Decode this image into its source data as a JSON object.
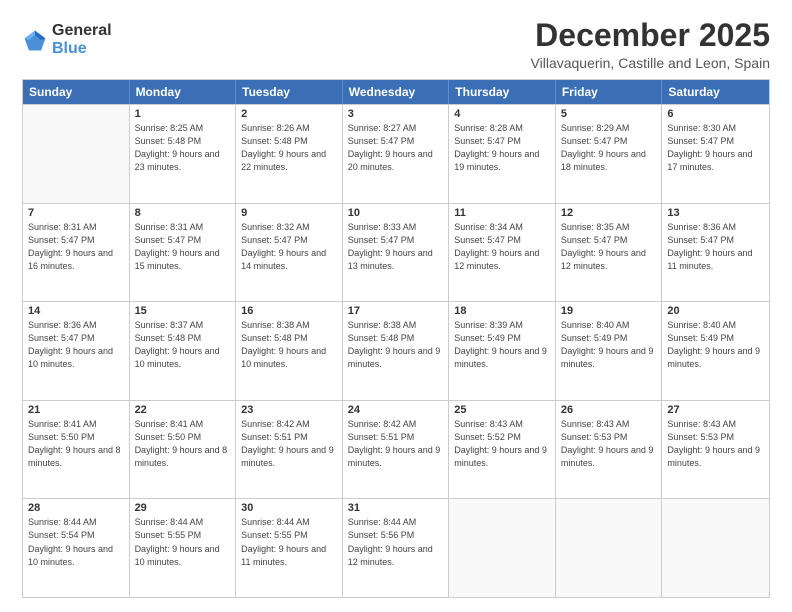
{
  "logo": {
    "general": "General",
    "blue": "Blue"
  },
  "title": "December 2025",
  "location": "Villavaquerin, Castille and Leon, Spain",
  "weekdays": [
    "Sunday",
    "Monday",
    "Tuesday",
    "Wednesday",
    "Thursday",
    "Friday",
    "Saturday"
  ],
  "rows": [
    [
      {
        "day": "",
        "sunrise": "",
        "sunset": "",
        "daylight": ""
      },
      {
        "day": "1",
        "sunrise": "Sunrise: 8:25 AM",
        "sunset": "Sunset: 5:48 PM",
        "daylight": "Daylight: 9 hours and 23 minutes."
      },
      {
        "day": "2",
        "sunrise": "Sunrise: 8:26 AM",
        "sunset": "Sunset: 5:48 PM",
        "daylight": "Daylight: 9 hours and 22 minutes."
      },
      {
        "day": "3",
        "sunrise": "Sunrise: 8:27 AM",
        "sunset": "Sunset: 5:47 PM",
        "daylight": "Daylight: 9 hours and 20 minutes."
      },
      {
        "day": "4",
        "sunrise": "Sunrise: 8:28 AM",
        "sunset": "Sunset: 5:47 PM",
        "daylight": "Daylight: 9 hours and 19 minutes."
      },
      {
        "day": "5",
        "sunrise": "Sunrise: 8:29 AM",
        "sunset": "Sunset: 5:47 PM",
        "daylight": "Daylight: 9 hours and 18 minutes."
      },
      {
        "day": "6",
        "sunrise": "Sunrise: 8:30 AM",
        "sunset": "Sunset: 5:47 PM",
        "daylight": "Daylight: 9 hours and 17 minutes."
      }
    ],
    [
      {
        "day": "7",
        "sunrise": "Sunrise: 8:31 AM",
        "sunset": "Sunset: 5:47 PM",
        "daylight": "Daylight: 9 hours and 16 minutes."
      },
      {
        "day": "8",
        "sunrise": "Sunrise: 8:31 AM",
        "sunset": "Sunset: 5:47 PM",
        "daylight": "Daylight: 9 hours and 15 minutes."
      },
      {
        "day": "9",
        "sunrise": "Sunrise: 8:32 AM",
        "sunset": "Sunset: 5:47 PM",
        "daylight": "Daylight: 9 hours and 14 minutes."
      },
      {
        "day": "10",
        "sunrise": "Sunrise: 8:33 AM",
        "sunset": "Sunset: 5:47 PM",
        "daylight": "Daylight: 9 hours and 13 minutes."
      },
      {
        "day": "11",
        "sunrise": "Sunrise: 8:34 AM",
        "sunset": "Sunset: 5:47 PM",
        "daylight": "Daylight: 9 hours and 12 minutes."
      },
      {
        "day": "12",
        "sunrise": "Sunrise: 8:35 AM",
        "sunset": "Sunset: 5:47 PM",
        "daylight": "Daylight: 9 hours and 12 minutes."
      },
      {
        "day": "13",
        "sunrise": "Sunrise: 8:36 AM",
        "sunset": "Sunset: 5:47 PM",
        "daylight": "Daylight: 9 hours and 11 minutes."
      }
    ],
    [
      {
        "day": "14",
        "sunrise": "Sunrise: 8:36 AM",
        "sunset": "Sunset: 5:47 PM",
        "daylight": "Daylight: 9 hours and 10 minutes."
      },
      {
        "day": "15",
        "sunrise": "Sunrise: 8:37 AM",
        "sunset": "Sunset: 5:48 PM",
        "daylight": "Daylight: 9 hours and 10 minutes."
      },
      {
        "day": "16",
        "sunrise": "Sunrise: 8:38 AM",
        "sunset": "Sunset: 5:48 PM",
        "daylight": "Daylight: 9 hours and 10 minutes."
      },
      {
        "day": "17",
        "sunrise": "Sunrise: 8:38 AM",
        "sunset": "Sunset: 5:48 PM",
        "daylight": "Daylight: 9 hours and 9 minutes."
      },
      {
        "day": "18",
        "sunrise": "Sunrise: 8:39 AM",
        "sunset": "Sunset: 5:49 PM",
        "daylight": "Daylight: 9 hours and 9 minutes."
      },
      {
        "day": "19",
        "sunrise": "Sunrise: 8:40 AM",
        "sunset": "Sunset: 5:49 PM",
        "daylight": "Daylight: 9 hours and 9 minutes."
      },
      {
        "day": "20",
        "sunrise": "Sunrise: 8:40 AM",
        "sunset": "Sunset: 5:49 PM",
        "daylight": "Daylight: 9 hours and 9 minutes."
      }
    ],
    [
      {
        "day": "21",
        "sunrise": "Sunrise: 8:41 AM",
        "sunset": "Sunset: 5:50 PM",
        "daylight": "Daylight: 9 hours and 8 minutes."
      },
      {
        "day": "22",
        "sunrise": "Sunrise: 8:41 AM",
        "sunset": "Sunset: 5:50 PM",
        "daylight": "Daylight: 9 hours and 8 minutes."
      },
      {
        "day": "23",
        "sunrise": "Sunrise: 8:42 AM",
        "sunset": "Sunset: 5:51 PM",
        "daylight": "Daylight: 9 hours and 9 minutes."
      },
      {
        "day": "24",
        "sunrise": "Sunrise: 8:42 AM",
        "sunset": "Sunset: 5:51 PM",
        "daylight": "Daylight: 9 hours and 9 minutes."
      },
      {
        "day": "25",
        "sunrise": "Sunrise: 8:43 AM",
        "sunset": "Sunset: 5:52 PM",
        "daylight": "Daylight: 9 hours and 9 minutes."
      },
      {
        "day": "26",
        "sunrise": "Sunrise: 8:43 AM",
        "sunset": "Sunset: 5:53 PM",
        "daylight": "Daylight: 9 hours and 9 minutes."
      },
      {
        "day": "27",
        "sunrise": "Sunrise: 8:43 AM",
        "sunset": "Sunset: 5:53 PM",
        "daylight": "Daylight: 9 hours and 9 minutes."
      }
    ],
    [
      {
        "day": "28",
        "sunrise": "Sunrise: 8:44 AM",
        "sunset": "Sunset: 5:54 PM",
        "daylight": "Daylight: 9 hours and 10 minutes."
      },
      {
        "day": "29",
        "sunrise": "Sunrise: 8:44 AM",
        "sunset": "Sunset: 5:55 PM",
        "daylight": "Daylight: 9 hours and 10 minutes."
      },
      {
        "day": "30",
        "sunrise": "Sunrise: 8:44 AM",
        "sunset": "Sunset: 5:55 PM",
        "daylight": "Daylight: 9 hours and 11 minutes."
      },
      {
        "day": "31",
        "sunrise": "Sunrise: 8:44 AM",
        "sunset": "Sunset: 5:56 PM",
        "daylight": "Daylight: 9 hours and 12 minutes."
      },
      {
        "day": "",
        "sunrise": "",
        "sunset": "",
        "daylight": ""
      },
      {
        "day": "",
        "sunrise": "",
        "sunset": "",
        "daylight": ""
      },
      {
        "day": "",
        "sunrise": "",
        "sunset": "",
        "daylight": ""
      }
    ]
  ]
}
